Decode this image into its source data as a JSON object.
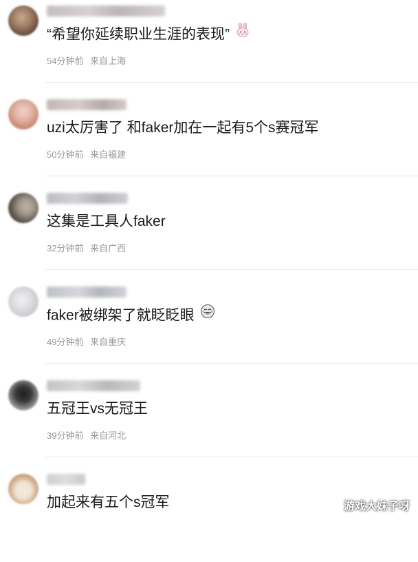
{
  "comments": [
    {
      "text": "“希望你延续职业生涯的表现”",
      "emoji": "bunny-emoji",
      "time": "54分钟前",
      "location": "来自上海",
      "avatar_colors": [
        "#7a5c48",
        "#c9a98c"
      ],
      "username_color": "#b9b4b4"
    },
    {
      "text": "uzi太厉害了 和faker加在一起有5个s赛冠军",
      "time": "50分钟前",
      "location": "来自福建",
      "avatar_colors": [
        "#e2b5a8",
        "#c98a72"
      ],
      "username_color": "#b7aaa8"
    },
    {
      "text": "这集是工具人faker",
      "time": "32分钟前",
      "location": "来自广西",
      "avatar_colors": [
        "#3f3b36",
        "#a49a8c"
      ],
      "username_color": "#b3b1b6"
    },
    {
      "text": "faker被绑架了就眨眨眼",
      "emoji": "laughing-tears-emoji",
      "time": "49分钟前",
      "location": "来自重庆",
      "avatar_colors": [
        "#dcdce0",
        "#c2c4c8"
      ],
      "username_color": "#b3b6bc"
    },
    {
      "text": "五冠王vs无冠王",
      "time": "39分钟前",
      "location": "来自河北",
      "avatar_colors": [
        "#2a2a2a",
        "#bdbdbd"
      ],
      "username_color": "#bcb9bd"
    },
    {
      "text": "加起来有五个s冠军",
      "time": "",
      "location": "",
      "avatar_colors": [
        "#c79a74",
        "#efe3d3"
      ],
      "username_color": "#c8c5c5"
    }
  ],
  "watermark": "游戏大妹子呀"
}
